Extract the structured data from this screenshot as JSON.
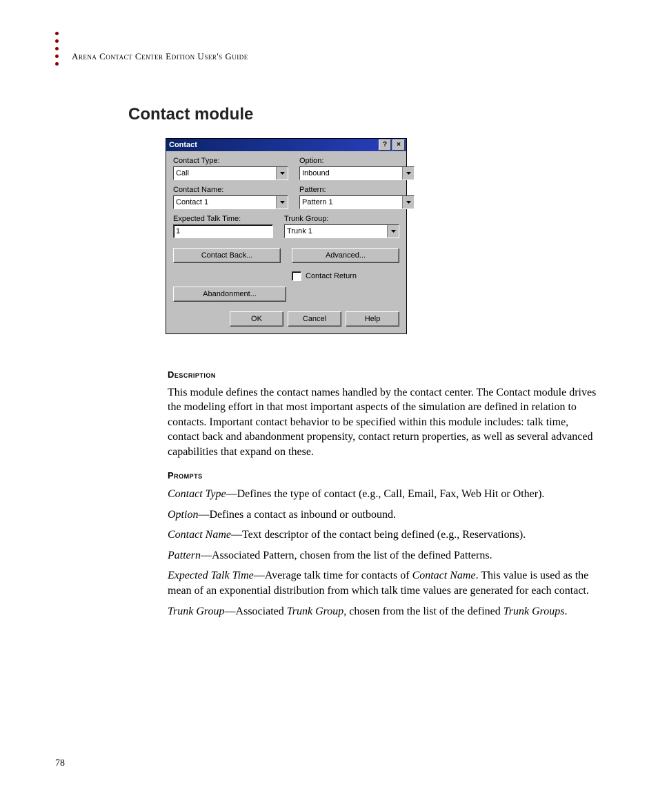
{
  "header": {
    "running_head": "Arena Contact Center Edition User's Guide"
  },
  "section_title": "Contact module",
  "dialog": {
    "title": "Contact",
    "help_glyph": "?",
    "close_glyph": "×",
    "labels": {
      "contact_type": "Contact Type:",
      "option": "Option:",
      "contact_name": "Contact Name:",
      "pattern": "Pattern:",
      "expected_talk": "Expected Talk Time:",
      "trunk_group": "Trunk Group:"
    },
    "values": {
      "contact_type": "Call",
      "option": "Inbound",
      "contact_name": "Contact 1",
      "pattern": "Pattern 1",
      "expected_talk": "1",
      "trunk_group": "Trunk 1"
    },
    "buttons": {
      "contact_back": "Contact Back...",
      "advanced": "Advanced...",
      "abandonment": "Abandonment...",
      "ok": "OK",
      "cancel": "Cancel",
      "help": "Help"
    },
    "checkbox_label": "Contact Return"
  },
  "description": {
    "heading": "Description",
    "text": "This module defines the contact names handled by the contact center. The Contact module drives the modeling effort in that most important aspects of the simulation are defined in relation to contacts. Important contact behavior to be specified within this module includes: talk time, contact back and abandonment propensity, contact return properties, as well as several advanced capabilities that expand on these."
  },
  "prompts": {
    "heading": "Prompts",
    "items": [
      {
        "term": "Contact Type",
        "desc": "—Defines the type of contact (e.g., Call, Email, Fax, Web Hit or Other)."
      },
      {
        "term": "Option",
        "desc": "—Defines a contact as inbound or outbound."
      },
      {
        "term": "Contact Name",
        "desc": "—Text descriptor of the contact being defined (e.g., Reservations)."
      },
      {
        "term": "Pattern",
        "desc": "—Associated Pattern, chosen from the list of the defined Patterns."
      }
    ],
    "talk_time": {
      "term": "Expected Talk Time",
      "pre": "—Average talk time for contacts of ",
      "ital": "Contact Name",
      "post": ". This value is used as the mean of an exponential distribution from which talk time values are generated for each contact."
    },
    "trunk": {
      "term": "Trunk Group",
      "pre": "—Associated ",
      "ital1": "Trunk Group",
      "mid": ", chosen from the list of the defined ",
      "ital2": "Trunk Groups",
      "post": "."
    }
  },
  "page_number": "78"
}
